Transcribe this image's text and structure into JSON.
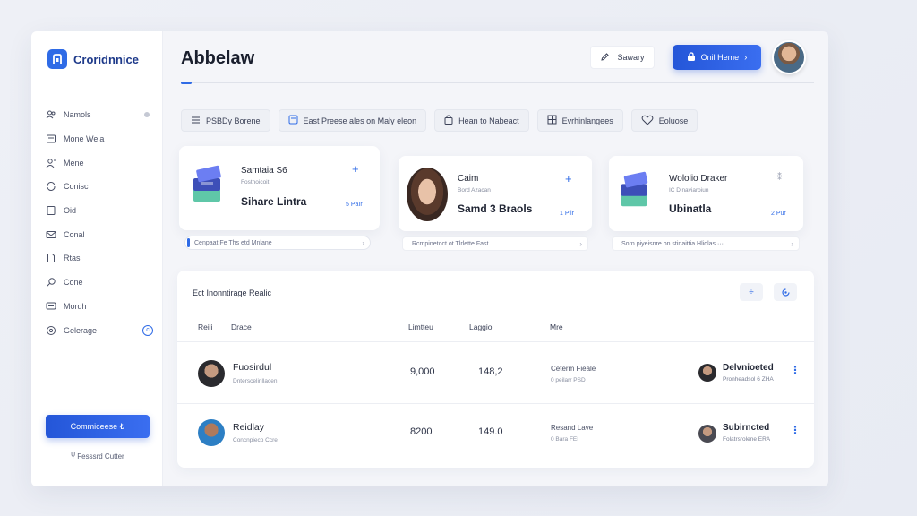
{
  "brand": {
    "name": "Croridnnice"
  },
  "sidebar": {
    "items": [
      {
        "label": "Namols",
        "icon": "people-icon"
      },
      {
        "label": "Mone Wela",
        "icon": "document-icon"
      },
      {
        "label": "Mene",
        "icon": "user-icon"
      },
      {
        "label": "Conisc",
        "icon": "refresh-icon"
      },
      {
        "label": "Oid",
        "icon": "page-icon"
      },
      {
        "label": "Conal",
        "icon": "mail-icon"
      },
      {
        "label": "Rtas",
        "icon": "file-icon"
      },
      {
        "label": "Cone",
        "icon": "search-icon"
      },
      {
        "label": "Mordh",
        "icon": "message-icon"
      },
      {
        "label": "Gelerage",
        "icon": "settings-icon"
      }
    ],
    "cta_label": "Commiceese ₺",
    "footer_link": "Ⴤ Fesssrd Cutter"
  },
  "header": {
    "title": "Abbelaw",
    "sketch_label": "Sawary",
    "primary_label": "Onil Heme"
  },
  "chips": [
    {
      "label": "PSBDy Borene",
      "icon": "list-icon"
    },
    {
      "label": "East Preese ales on Maly eleon",
      "icon": "board-icon"
    },
    {
      "label": "Hean to Nabeact",
      "icon": "bag-icon"
    },
    {
      "label": "Evrhinlangees",
      "icon": "grid-icon"
    },
    {
      "label": "Eoluose",
      "icon": "heart-icon"
    }
  ],
  "cards": [
    {
      "title": "Samtaia S6",
      "sub": "Fosthoicoit",
      "main": "Sihare Lintra",
      "meta": "5 Paır",
      "footer": "Cenpaat Fe Ths etd Mnlane"
    },
    {
      "title": "Caim",
      "sub": "Bord Azacan",
      "main": "Samd 3 Braols",
      "meta": "1 Pilr",
      "footer": "Rcmpinetoct ot Tlrlette Fast"
    },
    {
      "title": "Wololio Draker",
      "sub": "IC Dinaviaroiun",
      "main": "Ubinatla",
      "meta": "2 Pur",
      "footer": "Sorn piyeisnre on stinaittia Hlidlas ···"
    }
  ],
  "table": {
    "title": "Ect Inonntirage Realic",
    "columns": [
      "Reili",
      "Drace",
      "Limtteu",
      "Laggio",
      "Mre"
    ],
    "rows": [
      {
        "name": "Fuosirdul",
        "sub": "Dnterscelinllacen",
        "value1": "9,000",
        "value2": "148,2",
        "status": "Ceterm Fieale",
        "status_sub": "0 peilarr PSD",
        "owner": "Delvnioeted",
        "owner_sub": "Pronheadsol 6 ZHA"
      },
      {
        "name": "Reidlay",
        "sub": "Concnpieco Ccre",
        "value1": "8200",
        "value2": "149.0",
        "status": "Resand Lave",
        "status_sub": "0 Bara FEI",
        "owner": "Subirncted",
        "owner_sub": "Folatrsrolene ERA"
      }
    ]
  },
  "colors": {
    "accent": "#2f6be6",
    "primary": "#2456d8"
  }
}
